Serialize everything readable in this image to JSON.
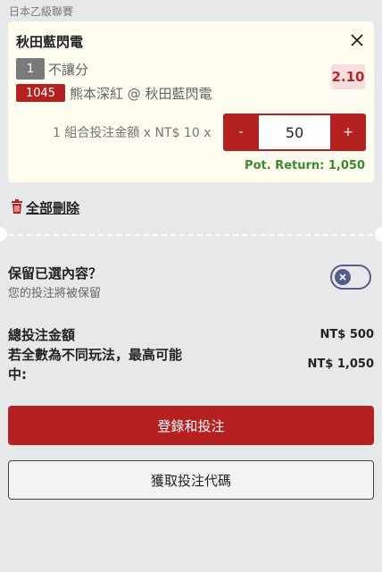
{
  "league": "日本乙級聯賽",
  "selection": {
    "team": "秋田藍閃電",
    "market_chip": "1",
    "market": "不讓分",
    "odds": "2.10",
    "match_id": "1045",
    "match": "熊本深紅 @ 秋田藍閃電",
    "combo_text": "1 組合投注金額 x NT$ 10 x",
    "stake": "50",
    "minus": "-",
    "plus": "+",
    "pot_return": "Pot. Return: 1,050"
  },
  "delete_all": "全部刪除",
  "keep": {
    "title": "保留已選內容？",
    "subtitle": "您的投注將被保留",
    "enabled": false
  },
  "summary": {
    "total_label": "總投注金額",
    "total_value": "NT$ 500",
    "max_label_line1": "若全數為不同玩法，最高可能",
    "max_label_line2": "中:",
    "max_value": "NT$ 1,050"
  },
  "buttons": {
    "login_bet": "登錄和投注",
    "get_code": "獲取投注代碼"
  },
  "colors": {
    "brand_red": "#b52020",
    "return_green": "#3c8a2e",
    "toggle": "#555c8a"
  }
}
